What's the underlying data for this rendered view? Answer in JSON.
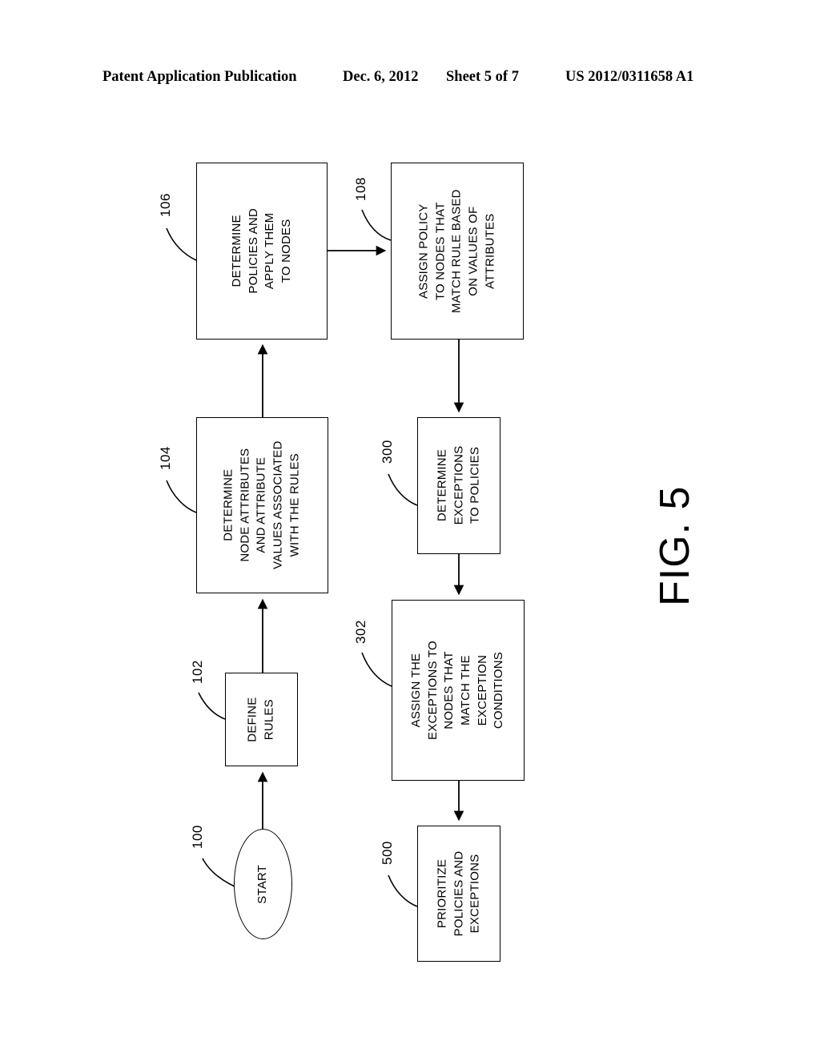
{
  "header": {
    "publication": "Patent Application Publication",
    "date": "Dec. 6, 2012",
    "sheet": "Sheet 5 of 7",
    "patent_number": "US 2012/0311658 A1"
  },
  "figure": {
    "caption": "FIG. 5"
  },
  "flowchart": {
    "nodes": [
      {
        "id": "start",
        "ref": "100",
        "shape": "oval",
        "label": "START"
      },
      {
        "id": "define_rules",
        "ref": "102",
        "shape": "rect",
        "label": "DEFINE\nRULES"
      },
      {
        "id": "determine_attributes",
        "ref": "104",
        "shape": "rect",
        "label": "DETERMINE\nNODE ATTRIBUTES\nAND ATTRIBUTE\nVALUES ASSOCIATED\nWITH THE RULES"
      },
      {
        "id": "determine_policies",
        "ref": "106",
        "shape": "rect",
        "label": "DETERMINE\nPOLICIES AND\nAPPLY THEM\nTO NODES"
      },
      {
        "id": "assign_policy",
        "ref": "108",
        "shape": "rect",
        "label": "ASSIGN POLICY\nTO NODES THAT\nMATCH RULE BASED\nON VALUES OF\nATTRIBUTES"
      },
      {
        "id": "determine_exceptions",
        "ref": "300",
        "shape": "rect",
        "label": "DETERMINE\nEXCEPTIONS\nTO POLICIES"
      },
      {
        "id": "assign_exceptions",
        "ref": "302",
        "shape": "rect",
        "label": "ASSIGN THE\nEXCEPTIONS TO\nNODES THAT\nMATCH THE\nEXCEPTION\nCONDITIONS"
      },
      {
        "id": "prioritize",
        "ref": "500",
        "shape": "rect",
        "label": "PRIORITIZE\nPOLICIES AND\nEXCEPTIONS"
      }
    ],
    "node_labels": {
      "start": "START",
      "define_rules_l1": "DEFINE",
      "define_rules_l2": "RULES",
      "determine_attributes_l1": "DETERMINE",
      "determine_attributes_l2": "NODE ATTRIBUTES",
      "determine_attributes_l3": "AND ATTRIBUTE",
      "determine_attributes_l4": "VALUES ASSOCIATED",
      "determine_attributes_l5": "WITH THE RULES",
      "determine_policies_l1": "DETERMINE",
      "determine_policies_l2": "POLICIES AND",
      "determine_policies_l3": "APPLY THEM",
      "determine_policies_l4": "TO NODES",
      "assign_policy_l1": "ASSIGN POLICY",
      "assign_policy_l2": "TO NODES THAT",
      "assign_policy_l3": "MATCH RULE BASED",
      "assign_policy_l4": "ON VALUES OF",
      "assign_policy_l5": "ATTRIBUTES",
      "determine_exceptions_l1": "DETERMINE",
      "determine_exceptions_l2": "EXCEPTIONS",
      "determine_exceptions_l3": "TO POLICIES",
      "assign_exceptions_l1": "ASSIGN THE",
      "assign_exceptions_l2": "EXCEPTIONS TO",
      "assign_exceptions_l3": "NODES THAT",
      "assign_exceptions_l4": "MATCH THE",
      "assign_exceptions_l5": "EXCEPTION",
      "assign_exceptions_l6": "CONDITIONS",
      "prioritize_l1": "PRIORITIZE",
      "prioritize_l2": "POLICIES AND",
      "prioritize_l3": "EXCEPTIONS"
    },
    "refs": {
      "start": "100",
      "define_rules": "102",
      "determine_attributes": "104",
      "determine_policies": "106",
      "assign_policy": "108",
      "determine_exceptions": "300",
      "assign_exceptions": "302",
      "prioritize": "500"
    },
    "edges": [
      {
        "from": "start",
        "to": "define_rules"
      },
      {
        "from": "define_rules",
        "to": "determine_attributes"
      },
      {
        "from": "determine_attributes",
        "to": "determine_policies"
      },
      {
        "from": "determine_policies",
        "to": "assign_policy"
      },
      {
        "from": "assign_policy",
        "to": "determine_exceptions"
      },
      {
        "from": "determine_exceptions",
        "to": "assign_exceptions"
      },
      {
        "from": "assign_exceptions",
        "to": "prioritize"
      }
    ]
  },
  "colors": {
    "ink": "#000000",
    "paper": "#ffffff"
  }
}
